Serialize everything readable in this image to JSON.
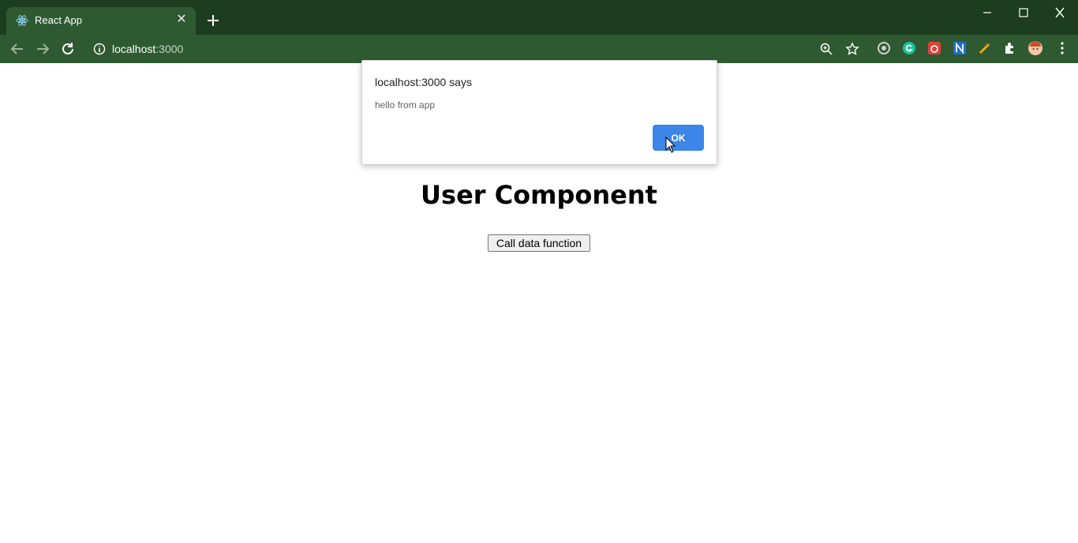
{
  "browser": {
    "tab": {
      "title": "React App",
      "favicon": "react-icon",
      "close": "✕"
    },
    "new_tab_icon": "plus-icon",
    "window_controls": [
      "minimize-icon",
      "maximize-icon",
      "close-icon"
    ],
    "nav": [
      "back-icon",
      "forward-icon",
      "reload-icon"
    ],
    "address": {
      "host": "localhost",
      "port": ":3000"
    },
    "omnibox_icons": [
      "zoom-icon",
      "bookmark-star-icon"
    ],
    "extensions": [
      "circle-extension-icon",
      "grammarly-icon",
      "red-extension-icon",
      "n-extension-icon",
      "pencil-extension-icon",
      "puzzle-icon",
      "profile-avatar",
      "kebab-menu-icon"
    ],
    "theme_colors": {
      "tabstrip": "#1c3d1e",
      "toolbar": "#2f5a31"
    }
  },
  "page": {
    "heading": "User Component",
    "button_label": "Call data function"
  },
  "dialog": {
    "title": "localhost:3000 says",
    "message": "hello from app",
    "ok_label": "OK",
    "ok_color": "#3b86e8"
  }
}
